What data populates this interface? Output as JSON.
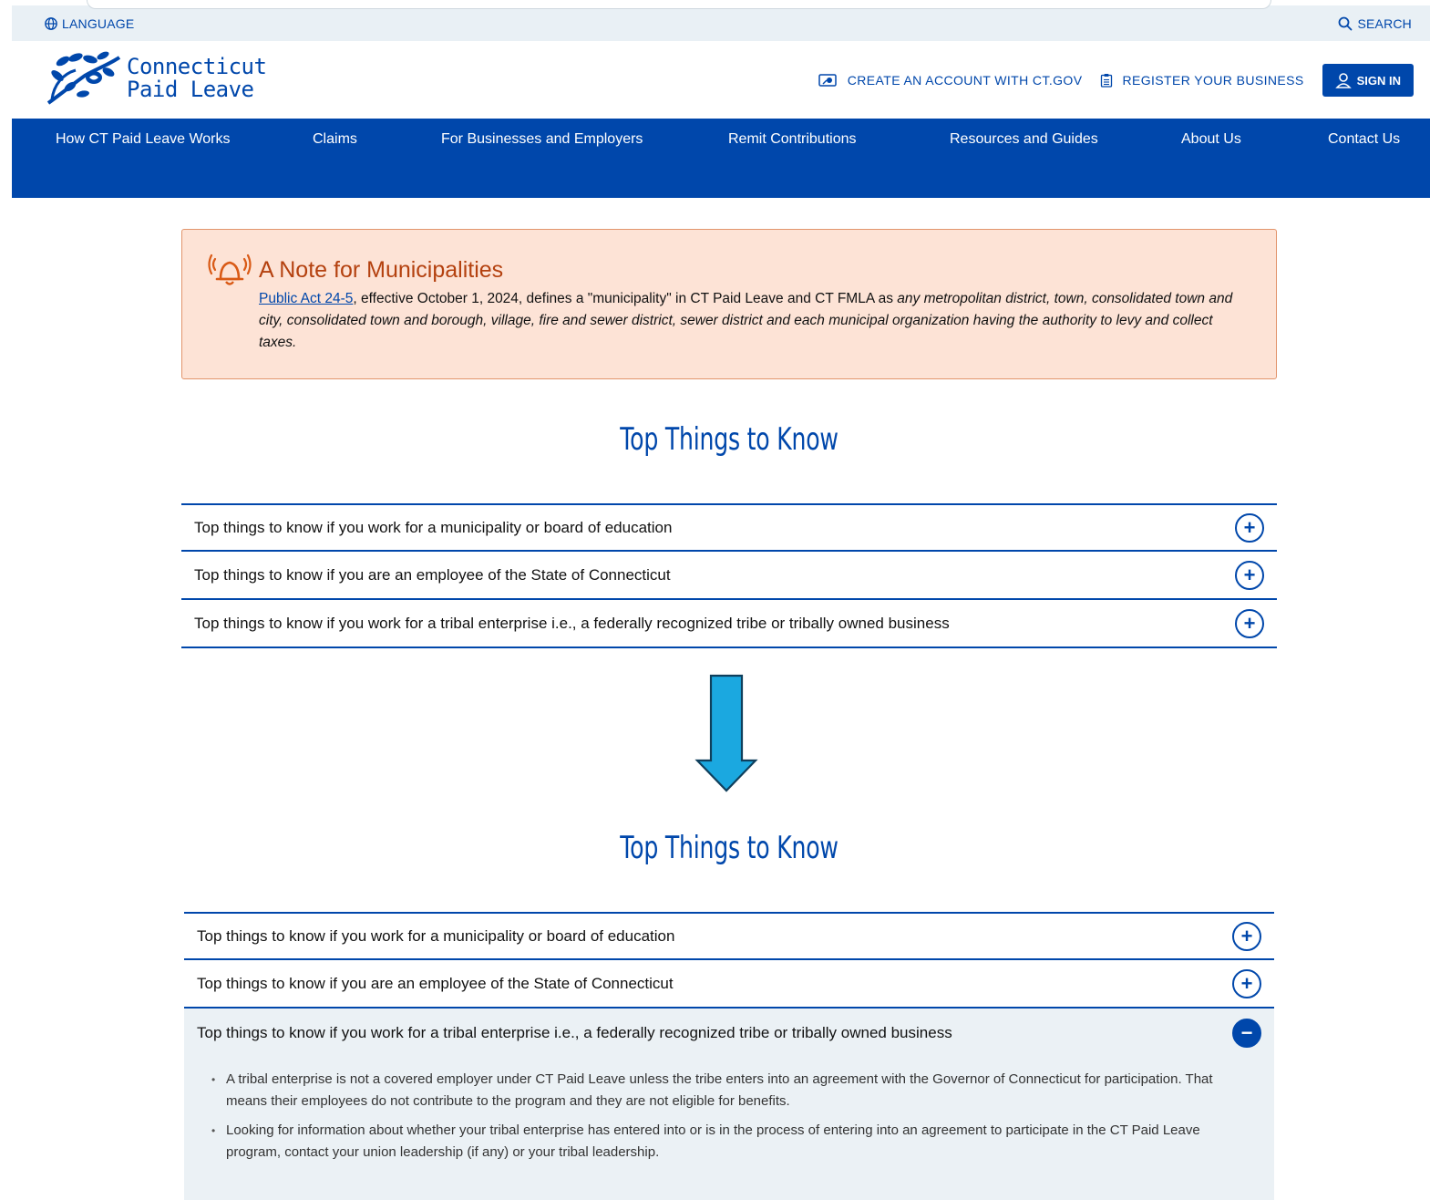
{
  "utility": {
    "language_label": "LANGUAGE",
    "search_label": "SEARCH"
  },
  "header": {
    "logo_line1": "Connecticut",
    "logo_line2": "Paid Leave",
    "create_account_label": "CREATE AN ACCOUNT WITH CT.GOV",
    "register_business_label": "REGISTER YOUR BUSINESS",
    "sign_in_label": "SIGN IN"
  },
  "nav": {
    "items": [
      {
        "label": "How CT Paid Leave Works"
      },
      {
        "label": "Claims"
      },
      {
        "label": "For Businesses and Employers"
      },
      {
        "label": "Remit Contributions"
      },
      {
        "label": "Resources and Guides"
      },
      {
        "label": "About Us"
      },
      {
        "label": "Contact Us"
      }
    ]
  },
  "note": {
    "title": "A Note for Municipalities",
    "link_text": "Public Act 24-5",
    "body_plain": ", effective October 1, 2024, defines a \"municipality\" in CT Paid Leave and CT FMLA as ",
    "body_italic": "any metropolitan district, town, consolidated town and city, consolidated town and borough, village, fire and sewer district, sewer district and each municipal organization having the authority to levy and collect taxes."
  },
  "sections": [
    {
      "title": "Top Things to Know",
      "items": [
        {
          "label": "Top things to know if you work for a municipality or board of education",
          "expanded": false
        },
        {
          "label": "Top things to know if you are an employee of the State of Connecticut",
          "expanded": false
        },
        {
          "label": "Top things to know if you work for a tribal enterprise i.e., a federally recognized tribe or tribally owned business",
          "expanded": false
        }
      ]
    },
    {
      "title": "Top Things to Know",
      "items": [
        {
          "label": "Top things to know if you work for a municipality or board of education",
          "expanded": false
        },
        {
          "label": "Top things to know if you are an employee of the State of Connecticut",
          "expanded": false
        },
        {
          "label": "Top things to know if you work for a tribal enterprise i.e., a federally recognized tribe or tribally owned business",
          "expanded": true,
          "bullets": [
            "A tribal enterprise is not a covered employer under CT Paid Leave unless the tribe enters into an agreement with the Governor of Connecticut for participation. That means their employees do not contribute to the program and they are not eligible for benefits.",
            "Looking for information about whether your tribal enterprise has entered into or is in the process of entering into an agreement to participate in the CT Paid Leave program, contact your union leadership (if any) or your tribal leadership."
          ]
        }
      ]
    }
  ],
  "icons": {
    "expand": "+",
    "collapse": "−"
  },
  "colors": {
    "brand_blue": "#0047ab",
    "note_bg": "#fde3d6",
    "note_accent": "#b4410f",
    "arrow": "#1ba8e0",
    "panel_bg": "#ebf1f5"
  }
}
